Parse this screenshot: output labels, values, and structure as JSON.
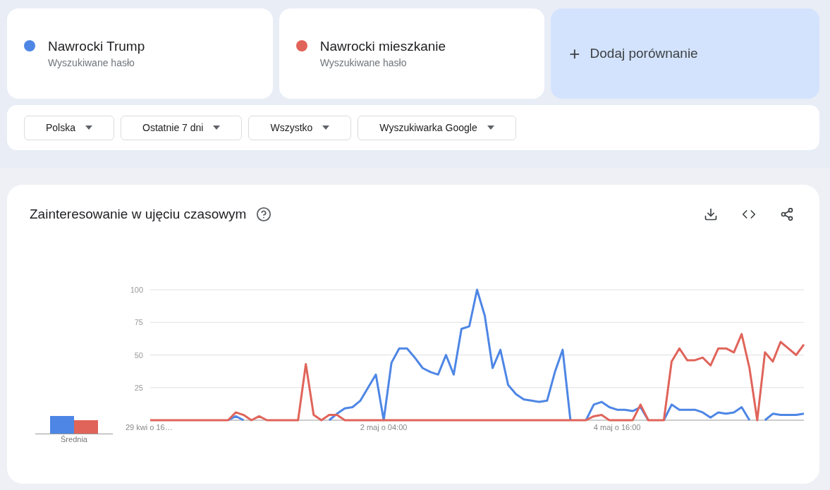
{
  "terms": [
    {
      "name": "Nawrocki Trump",
      "subtitle": "Wyszukiwane hasło",
      "color": "#4e86e5"
    },
    {
      "name": "Nawrocki mieszkanie",
      "subtitle": "Wyszukiwane hasło",
      "color": "#e0645a"
    }
  ],
  "add_comparison": {
    "icon": "+",
    "label": "Dodaj porównanie"
  },
  "filters": [
    {
      "label": "Polska"
    },
    {
      "label": "Ostatnie 7 dni"
    },
    {
      "label": "Wszystko"
    },
    {
      "label": "Wyszukiwarka Google"
    }
  ],
  "interest": {
    "title": "Zainteresowanie w ujęciu czasowym",
    "average": {
      "label": "Średnia"
    },
    "chart_data": {
      "type": "line",
      "categories": [
        "29 kwi o 16…",
        null,
        null,
        null,
        null,
        null,
        null,
        null,
        null,
        null,
        null,
        null,
        null,
        null,
        null,
        null,
        null,
        null,
        null,
        null,
        null,
        null,
        null,
        null,
        null,
        null,
        null,
        null,
        null,
        null,
        "2 maj o 04:00",
        null,
        null,
        null,
        null,
        null,
        null,
        null,
        null,
        null,
        null,
        null,
        null,
        null,
        null,
        null,
        null,
        null,
        null,
        null,
        null,
        null,
        null,
        null,
        null,
        null,
        null,
        null,
        null,
        null,
        "4 maj o 16:00",
        null,
        null,
        null,
        null,
        null,
        null,
        null,
        null,
        null,
        null,
        null,
        null,
        null,
        null,
        null,
        null,
        null,
        null,
        null,
        null,
        null,
        null,
        null,
        null
      ],
      "series": [
        {
          "color": "#4e86e5",
          "values": [
            null,
            null,
            null,
            null,
            null,
            null,
            null,
            null,
            null,
            null,
            0,
            3,
            0,
            null,
            null,
            null,
            null,
            null,
            null,
            null,
            null,
            null,
            null,
            0,
            5,
            9,
            10,
            15,
            25,
            35,
            0,
            44,
            55,
            55,
            48,
            40,
            37,
            35,
            50,
            35,
            70,
            72,
            100,
            80,
            40,
            54,
            27,
            20,
            16,
            15,
            14,
            15,
            37,
            54,
            0,
            null,
            0,
            12,
            14,
            10,
            8,
            8,
            7,
            10,
            0,
            null,
            0,
            12,
            8,
            8,
            8,
            6,
            2,
            6,
            5,
            6,
            10,
            0,
            null,
            0,
            5,
            4,
            4,
            4,
            5
          ]
        },
        {
          "color": "#e0645a",
          "values": [
            0,
            0,
            0,
            0,
            0,
            0,
            0,
            0,
            0,
            0,
            0,
            6,
            4,
            0,
            3,
            0,
            0,
            0,
            0,
            0,
            43,
            4,
            0,
            4,
            4,
            0,
            0,
            0,
            0,
            0,
            0,
            0,
            0,
            0,
            0,
            0,
            0,
            0,
            0,
            0,
            0,
            0,
            0,
            0,
            0,
            0,
            0,
            0,
            0,
            0,
            0,
            0,
            0,
            0,
            0,
            0,
            0,
            3,
            4,
            0,
            0,
            0,
            0,
            12,
            0,
            0,
            0,
            45,
            55,
            46,
            46,
            48,
            42,
            55,
            55,
            52,
            66,
            40,
            0,
            52,
            45,
            60,
            55,
            50,
            58
          ]
        }
      ],
      "grid": true,
      "ylim": [
        0,
        100
      ],
      "yticks": [
        {
          "value": 25,
          "label": "25"
        },
        {
          "value": 50,
          "label": "50"
        },
        {
          "value": 75,
          "label": "75"
        },
        {
          "value": 100,
          "label": "100"
        }
      ]
    }
  }
}
